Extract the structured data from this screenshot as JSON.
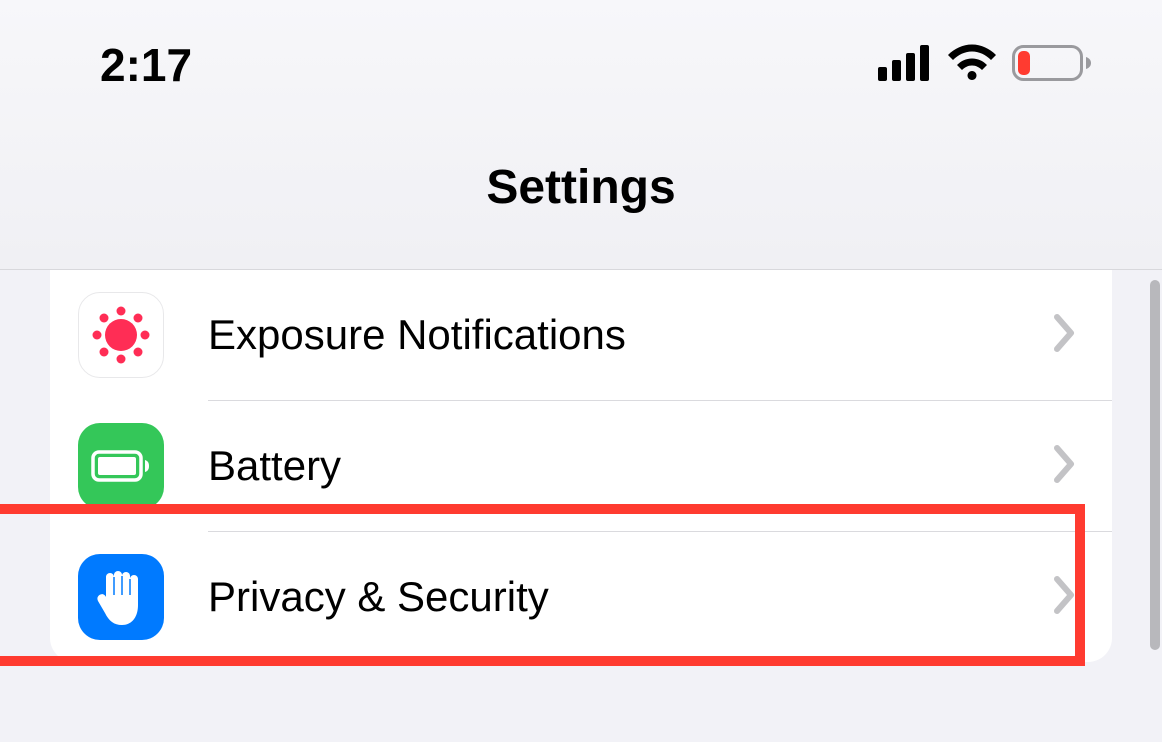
{
  "status": {
    "time": "2:17"
  },
  "header": {
    "title": "Settings"
  },
  "items": [
    {
      "label": "Exposure Notifications",
      "icon": "exposure"
    },
    {
      "label": "Battery",
      "icon": "battery"
    },
    {
      "label": "Privacy & Security",
      "icon": "privacy"
    }
  ]
}
